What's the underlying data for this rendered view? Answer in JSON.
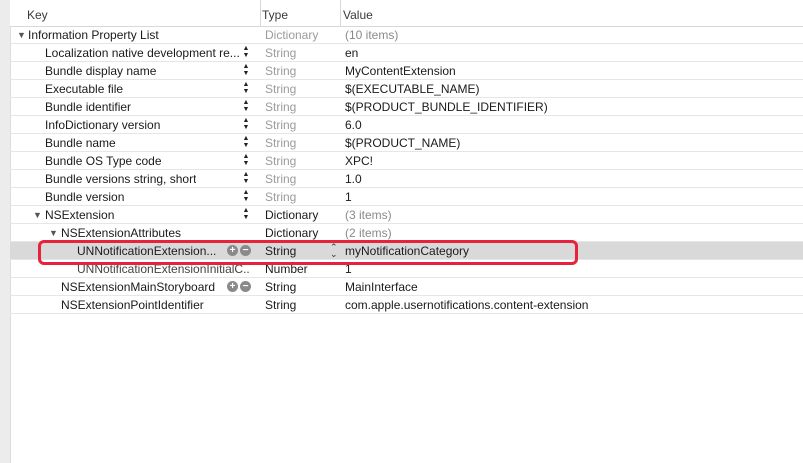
{
  "header": {
    "key": "Key",
    "type": "Type",
    "value": "Value"
  },
  "rows": [
    {
      "key": "Information Property List",
      "type": "Dictionary",
      "value": "(10 items)"
    },
    {
      "key": "Localization native development re...",
      "type": "String",
      "value": "en"
    },
    {
      "key": "Bundle display name",
      "type": "String",
      "value": "MyContentExtension"
    },
    {
      "key": "Executable file",
      "type": "String",
      "value": "$(EXECUTABLE_NAME)"
    },
    {
      "key": "Bundle identifier",
      "type": "String",
      "value": "$(PRODUCT_BUNDLE_IDENTIFIER)"
    },
    {
      "key": "InfoDictionary version",
      "type": "String",
      "value": "6.0"
    },
    {
      "key": "Bundle name",
      "type": "String",
      "value": "$(PRODUCT_NAME)"
    },
    {
      "key": "Bundle OS Type code",
      "type": "String",
      "value": "XPC!"
    },
    {
      "key": "Bundle versions string, short",
      "type": "String",
      "value": "1.0"
    },
    {
      "key": "Bundle version",
      "type": "String",
      "value": "1"
    },
    {
      "key": "NSExtension",
      "type": "Dictionary",
      "value": "(3 items)"
    },
    {
      "key": "NSExtensionAttributes",
      "type": "Dictionary",
      "value": "(2 items)"
    },
    {
      "key": "UNNotificationExtension...",
      "type": "String",
      "value": "myNotificationCategory"
    },
    {
      "key": "UNNotificationExtensionInitialC...",
      "type": "Number",
      "value": "1"
    },
    {
      "key": "NSExtensionMainStoryboard",
      "type": "String",
      "value": "MainInterface"
    },
    {
      "key": "NSExtensionPointIdentifier",
      "type": "String",
      "value": "com.apple.usernotifications.content-extension"
    }
  ],
  "colors": {
    "highlight": "#e8213d",
    "selected_row": "#d9d9d9"
  }
}
